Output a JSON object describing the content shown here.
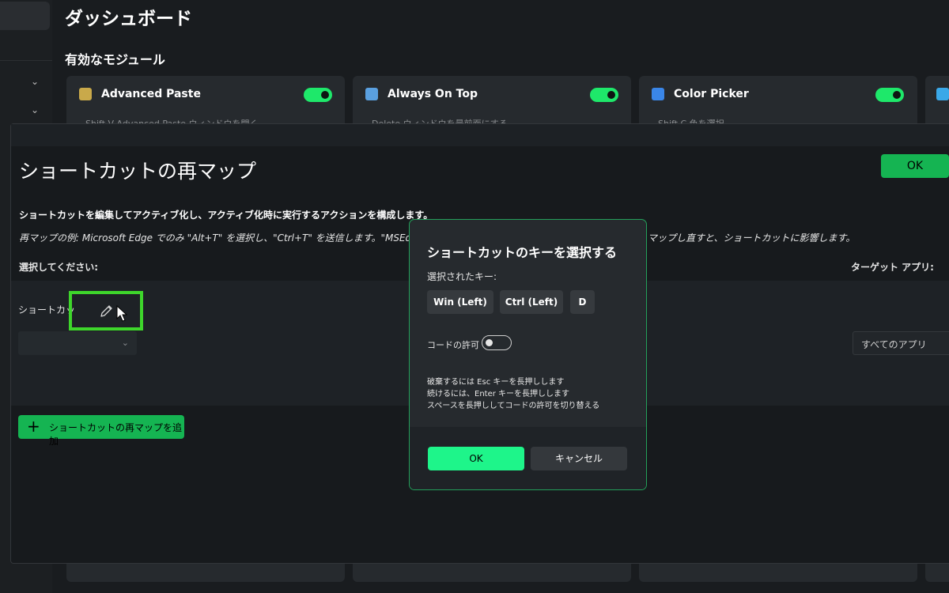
{
  "dashboard": {
    "title": "ダッシュボード",
    "section_title": "有効なモジュール",
    "cards": [
      {
        "name": "Advanced Paste",
        "shortcut": "Shift  V  Advanced Paste ウィンドウを開く",
        "icon": "clipboard-sparkle-icon"
      },
      {
        "name": "Always On Top",
        "shortcut": "Delete  ウィンドウを最前面にする",
        "icon": "stacked-windows-icon"
      },
      {
        "name": "Color Picker",
        "shortcut": "Shift  C  色を選択",
        "icon": "eyedropper-icon"
      }
    ]
  },
  "remap_window": {
    "title": "ショートカットの再マップ",
    "ok_label": "OK",
    "description": "ショートカットを編集してアクティブ化し、アクティブ化時に実行するアクションを構成します。",
    "example": "再マップの例: Microsoft Edge でのみ \"Alt+T\" を選択し、\"Ctrl+T\" を送信します。\"MSEdge",
    "example_tail": "マップし直すと、ショートカットに影響します。",
    "select_label": "選択してください:",
    "target_app_label": "ターゲット アプリ:",
    "shortcut_label": "ショートカット",
    "all_apps": "すべてのアプリ",
    "add_button": "ショートカットの再マップを追加"
  },
  "dialog": {
    "title": "ショートカットのキーを選択する",
    "selected_keys_label": "選択されたキー:",
    "keys": [
      "Win (Left)",
      "Ctrl (Left)",
      "D"
    ],
    "chord_label": "コードの許可",
    "hints": [
      "破棄するには Esc キーを長押しします",
      "続けるには、Enter キーを長押しします",
      "スペースを長押ししてコードの許可を切り替える"
    ],
    "ok_label": "OK",
    "cancel_label": "キャンセル"
  },
  "colors": {
    "accent": "#15b452",
    "accent_bright": "#1ef58a",
    "highlight_box": "#3ed62b"
  }
}
